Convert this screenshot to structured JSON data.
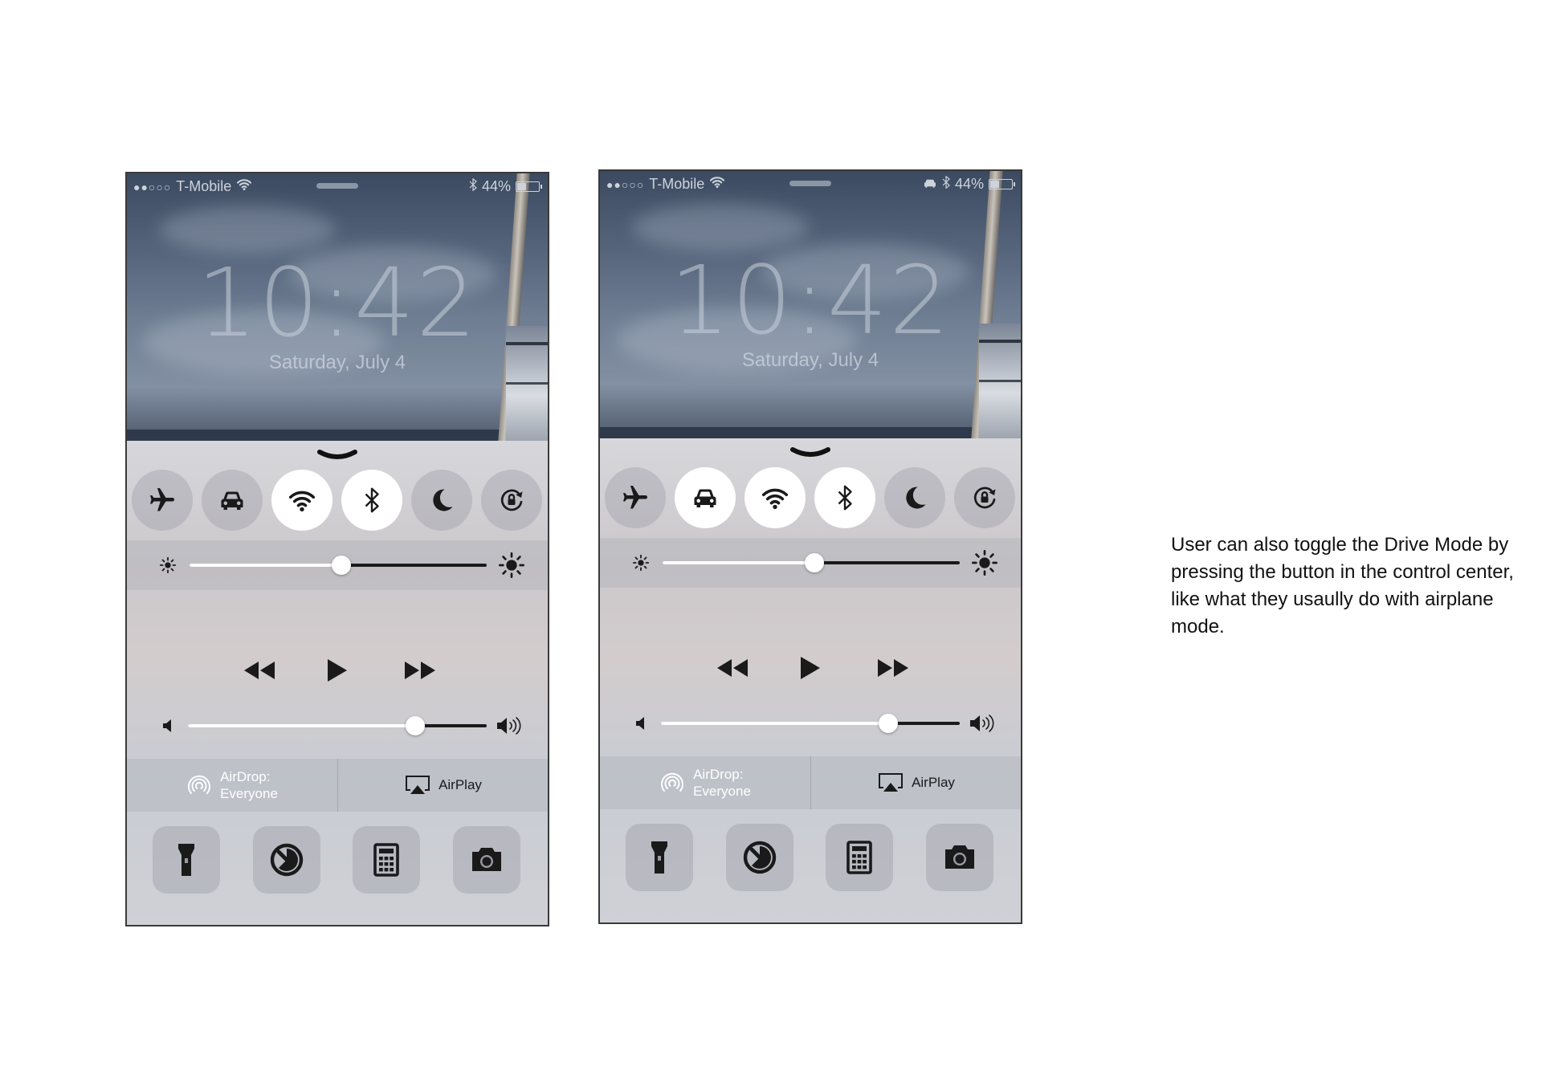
{
  "phones": [
    {
      "status": {
        "carrier": "T-Mobile",
        "battery": "44%",
        "battery_level": 0.44,
        "show_car_icon": false
      },
      "time": "10:42",
      "date": "Saturday, July 4",
      "toggles": [
        {
          "name": "airplane-mode",
          "icon": "airplane-icon",
          "on": false
        },
        {
          "name": "drive-mode",
          "icon": "car-icon",
          "on": false
        },
        {
          "name": "wifi",
          "icon": "wifi-icon",
          "on": true
        },
        {
          "name": "bluetooth",
          "icon": "bluetooth-icon",
          "on": true
        },
        {
          "name": "do-not-disturb",
          "icon": "moon-icon",
          "on": false
        },
        {
          "name": "rotation-lock",
          "icon": "rotation-lock-icon",
          "on": false
        }
      ],
      "brightness": 0.51,
      "volume": 0.76,
      "airdrop": {
        "line1": "AirDrop:",
        "line2": "Everyone"
      },
      "airplay": "AirPlay",
      "apps": [
        "flashlight-icon",
        "timer-icon",
        "calculator-icon",
        "camera-icon"
      ]
    },
    {
      "status": {
        "carrier": "T-Mobile",
        "battery": "44%",
        "battery_level": 0.44,
        "show_car_icon": true
      },
      "time": "10:42",
      "date": "Saturday, July 4",
      "toggles": [
        {
          "name": "airplane-mode",
          "icon": "airplane-icon",
          "on": false
        },
        {
          "name": "drive-mode",
          "icon": "car-icon",
          "on": true
        },
        {
          "name": "wifi",
          "icon": "wifi-icon",
          "on": true
        },
        {
          "name": "bluetooth",
          "icon": "bluetooth-icon",
          "on": true
        },
        {
          "name": "do-not-disturb",
          "icon": "moon-icon",
          "on": false
        },
        {
          "name": "rotation-lock",
          "icon": "rotation-lock-icon",
          "on": false
        }
      ],
      "brightness": 0.51,
      "volume": 0.76,
      "airdrop": {
        "line1": "AirDrop:",
        "line2": "Everyone"
      },
      "airplay": "AirPlay",
      "apps": [
        "flashlight-icon",
        "timer-icon",
        "calculator-icon",
        "camera-icon"
      ]
    }
  ],
  "note": "User can also toggle the Drive Mode by pressing the button in the control center, like what they usaully do with airplane mode.",
  "colors": {
    "toggle_on": "#ffffff",
    "toggle_off": "#9a9aa5",
    "icon": "#1a1a1a"
  }
}
